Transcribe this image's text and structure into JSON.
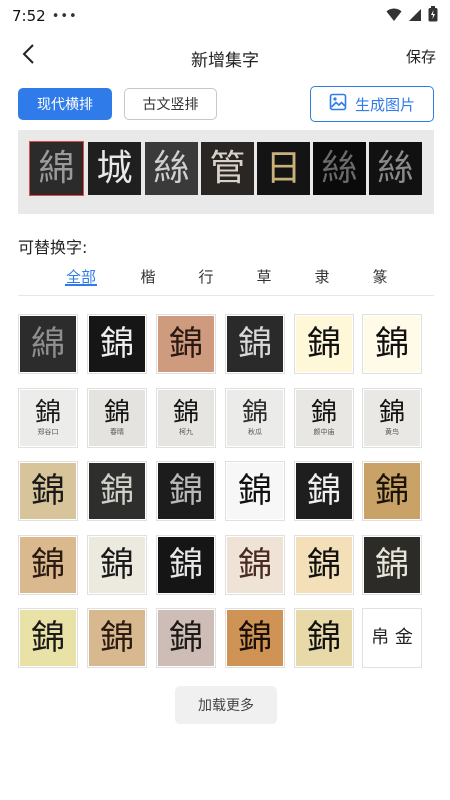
{
  "status": {
    "time": "7:52",
    "dots": "•••"
  },
  "nav": {
    "title": "新增集字",
    "save_label": "保存"
  },
  "modes": {
    "modern_label": "现代横排",
    "ancient_label": "古文竖排",
    "generate_label": "生成图片"
  },
  "preview": {
    "chars": [
      {
        "char": "綿",
        "bg": "#2b2b2b",
        "fg": "#9a9a9a",
        "selected": true
      },
      {
        "char": "城",
        "bg": "#1f1f1f",
        "fg": "#e8e8e8",
        "selected": false
      },
      {
        "char": "絲",
        "bg": "#3a3a3a",
        "fg": "#d0d0d0",
        "selected": false
      },
      {
        "char": "管",
        "bg": "#2a2623",
        "fg": "#d9d2c8",
        "selected": false
      },
      {
        "char": "日",
        "bg": "#141414",
        "fg": "#c9b27a",
        "selected": false
      },
      {
        "char": "絲",
        "bg": "#0a0a0a",
        "fg": "#6a6a6a",
        "selected": false
      },
      {
        "char": "絲",
        "bg": "#111111",
        "fg": "#8a8a8a",
        "selected": false
      }
    ]
  },
  "alternates_label": "可替换字:",
  "style_tabs": [
    {
      "label": "全部",
      "active": true
    },
    {
      "label": "楷",
      "active": false
    },
    {
      "label": "行",
      "active": false
    },
    {
      "label": "草",
      "active": false
    },
    {
      "label": "隶",
      "active": false
    },
    {
      "label": "篆",
      "active": false
    }
  ],
  "grid": [
    [
      {
        "char": "綿",
        "bg": "#2c2c2c",
        "fg": "#8f8f8f",
        "caption": ""
      },
      {
        "char": "錦",
        "bg": "#161616",
        "fg": "#eeeeee",
        "caption": ""
      },
      {
        "char": "錦",
        "bg": "#cf9b7e",
        "fg": "#2a1a12",
        "caption": ""
      },
      {
        "char": "錦",
        "bg": "#2a2a2a",
        "fg": "#d8d8d8",
        "caption": ""
      },
      {
        "char": "錦",
        "bg": "#fff8d8",
        "fg": "#111111",
        "caption": ""
      },
      {
        "char": "錦",
        "bg": "#fffbe8",
        "fg": "#111111",
        "caption": ""
      }
    ],
    [
      {
        "char": "錦",
        "bg": "#ececea",
        "fg": "#1a1a1a",
        "caption": "郑谷口"
      },
      {
        "char": "錦",
        "bg": "#e4e3df",
        "fg": "#111111",
        "caption": "春晴"
      },
      {
        "char": "錦",
        "bg": "#e6e5e1",
        "fg": "#111111",
        "caption": "柯九"
      },
      {
        "char": "錦",
        "bg": "#ebebea",
        "fg": "#2b2b2b",
        "caption": "秋瓜"
      },
      {
        "char": "錦",
        "bg": "#e8e7e3",
        "fg": "#111111",
        "caption": "颜中庙"
      },
      {
        "char": "錦",
        "bg": "#e9e8e5",
        "fg": "#111111",
        "caption": "黄鸟"
      }
    ],
    [
      {
        "char": "錦",
        "bg": "#d7c49a",
        "fg": "#1a1a1a",
        "caption": ""
      },
      {
        "char": "錦",
        "bg": "#2e2e2c",
        "fg": "#d0cfc8",
        "caption": ""
      },
      {
        "char": "錦",
        "bg": "#1c1c1c",
        "fg": "#b8b8b8",
        "caption": ""
      },
      {
        "char": "錦",
        "bg": "#f7f7f7",
        "fg": "#111111",
        "caption": ""
      },
      {
        "char": "錦",
        "bg": "#1e1e1e",
        "fg": "#f0f0f0",
        "caption": ""
      },
      {
        "char": "錦",
        "bg": "#c9a267",
        "fg": "#1a1308",
        "caption": ""
      }
    ],
    [
      {
        "char": "錦",
        "bg": "#d9b98d",
        "fg": "#2a1a10",
        "caption": ""
      },
      {
        "char": "錦",
        "bg": "#ece9df",
        "fg": "#1a1a1a",
        "caption": ""
      },
      {
        "char": "錦",
        "bg": "#151515",
        "fg": "#e6e6e6",
        "caption": ""
      },
      {
        "char": "錦",
        "bg": "#efe3d6",
        "fg": "#4a2a22",
        "caption": ""
      },
      {
        "char": "錦",
        "bg": "#f3e0b8",
        "fg": "#111111",
        "caption": ""
      },
      {
        "char": "錦",
        "bg": "#2c2b28",
        "fg": "#e8e4d8",
        "caption": ""
      }
    ],
    [
      {
        "char": "錦",
        "bg": "#e9e2a6",
        "fg": "#1a1a1a",
        "caption": ""
      },
      {
        "char": "錦",
        "bg": "#d8b98f",
        "fg": "#2a1a10",
        "caption": ""
      },
      {
        "char": "錦",
        "bg": "#cdbdb6",
        "fg": "#1e1a18",
        "caption": ""
      },
      {
        "char": "錦",
        "bg": "#cf9355",
        "fg": "#1a0f06",
        "caption": ""
      },
      {
        "char": "錦",
        "bg": "#e7d9a8",
        "fg": "#111111",
        "caption": ""
      },
      {
        "char": "帛 金",
        "bg": "#ffffff",
        "fg": "#222222",
        "caption": ""
      }
    ]
  ],
  "load_more_label": "加载更多",
  "colors": {
    "accent": "#2f7bea",
    "selected_outline": "#e24a4a"
  }
}
